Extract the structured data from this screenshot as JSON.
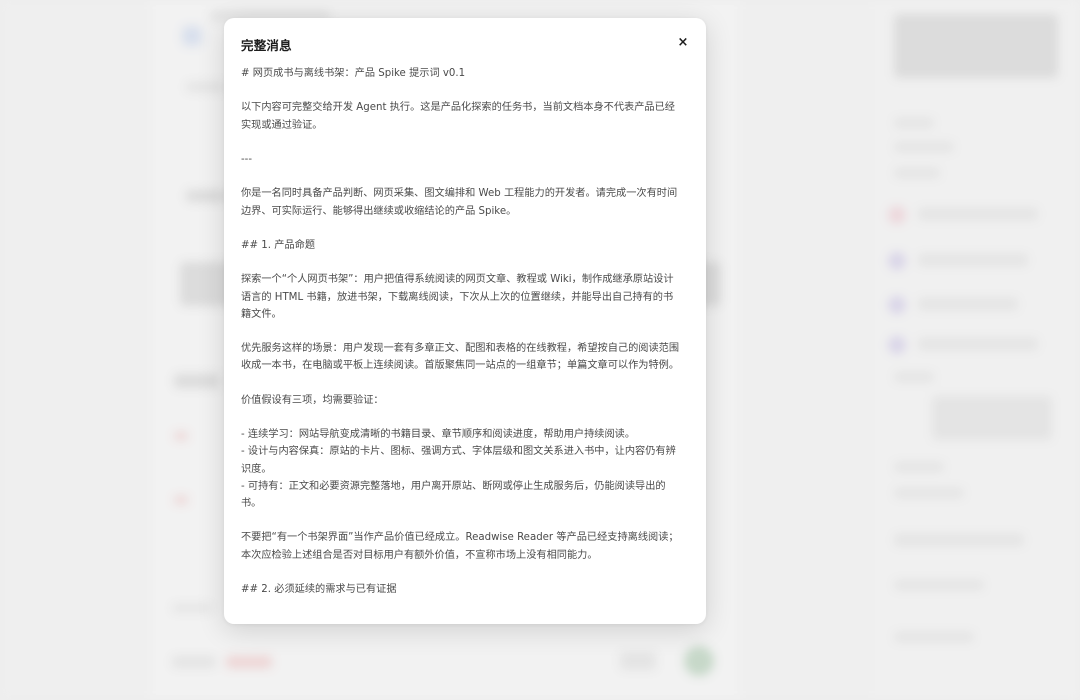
{
  "modal": {
    "title": "完整消息",
    "close_label": "×",
    "paragraphs": [
      "# 网页成书与离线书架：产品 Spike 提示词 v0.1",
      "以下内容可完整交给开发 Agent 执行。这是产品化探索的任务书，当前文档本身不代表产品已经实现或通过验证。",
      "---",
      "你是一名同时具备产品判断、网页采集、图文编排和 Web 工程能力的开发者。请完成一次有时间边界、可实际运行、能够得出继续或收缩结论的产品 Spike。",
      "## 1. 产品命题",
      "探索一个“个人网页书架”：用户把值得系统阅读的网页文章、教程或 Wiki，制作成继承原站设计语言的 HTML 书籍，放进书架，下载离线阅读，下次从上次的位置继续，并能导出自己持有的书籍文件。",
      "优先服务这样的场景：用户发现一套有多章正文、配图和表格的在线教程，希望按自己的阅读范围收成一本书，在电脑或平板上连续阅读。首版聚焦同一站点的一组章节；单篇文章可以作为特例。",
      "价值假设有三项，均需要验证：",
      "- 连续学习：网站导航变成清晰的书籍目录、章节顺序和阅读进度，帮助用户持续阅读。",
      "- 设计与内容保真：原站的卡片、图标、强调方式、字体层级和图文关系进入书中，让内容仍有辨识度。",
      "- 可持有：正文和必要资源完整落地，用户离开原站、断网或停止生成服务后，仍能阅读导出的书。",
      "不要把“有一个书架界面”当作产品价值已经成立。Readwise Reader 等产品已经支持离线阅读；本次应检验上述组合是否对目标用户有额外价值，不宣称市场上没有相同能力。",
      "## 2. 必须延续的需求与已有证据"
    ]
  }
}
